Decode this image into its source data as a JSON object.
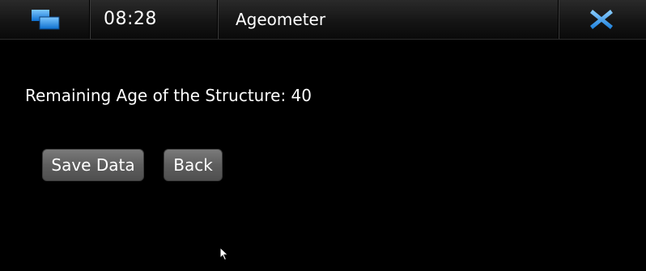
{
  "statusbar": {
    "switcher_icon": "task-switcher-icon",
    "time": "08:28",
    "app_title": "Ageometer",
    "close_icon": "close-icon",
    "accent": "#2a8fe0"
  },
  "main": {
    "message": "Remaining Age of the Structure: 40"
  },
  "buttons": {
    "save_label": "Save Data",
    "back_label": "Back"
  }
}
